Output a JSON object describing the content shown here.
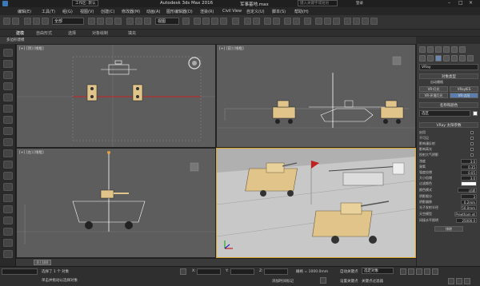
{
  "window": {
    "title": "Autodesk 3ds Max 2016",
    "file": "军事基地.max",
    "workspace": "工作区: 默认",
    "search_placeholder": "键入关键字或短语",
    "user": "登录"
  },
  "menu": [
    "编辑(E)",
    "工具(T)",
    "组(G)",
    "视图(V)",
    "创建(C)",
    "修改器(M)",
    "动画(A)",
    "图形编辑器(D)",
    "渲染(R)",
    "Civil View",
    "自定义(U)",
    "脚本(S)",
    "帮助(H)"
  ],
  "toolbar": {
    "selection_filter": "全部",
    "view_dropdown": "视图"
  },
  "ribbon": {
    "tabs": [
      "建模",
      "自由形式",
      "选择",
      "对象绘制",
      "填充"
    ],
    "sub": "多边形建模"
  },
  "viewports": {
    "top_label": "[+] [顶] [线框]",
    "front_label": "[+] [前] [线框]",
    "left_label": "[+] [左] [线框]",
    "persp_label": "[+] [透视] [真实]"
  },
  "command_panel": {
    "search_placeholder": "",
    "category": "VRay",
    "object_type_header": "对象类型",
    "auto_grid": "自动栅格",
    "buttons": [
      "VR-灯光",
      "VRayIES",
      "VR-环境灯光",
      "VR-太阳"
    ],
    "name_color_header": "名称和颜色",
    "name_value": "选区",
    "params_header": "VRay 太阳参数",
    "rows": [
      {
        "label": "启用",
        "type": "chk"
      },
      {
        "label": "不可见",
        "type": "chk"
      },
      {
        "label": "影响漫反射",
        "type": "chk"
      },
      {
        "label": "影响高光",
        "type": "chk"
      },
      {
        "label": "投射大气阴影",
        "type": "chk"
      },
      {
        "label": "浊度",
        "value": "3.0"
      },
      {
        "label": "臭氧",
        "value": "0.35"
      },
      {
        "label": "强度倍增",
        "value": "0.05"
      },
      {
        "label": "大小倍增",
        "value": "3.0"
      },
      {
        "label": "过滤颜色",
        "value": ""
      },
      {
        "label": "颜色模式",
        "value": "过滤"
      },
      {
        "label": "阴影细分",
        "value": "3"
      },
      {
        "label": "阴影偏移",
        "value": "0.2mm"
      },
      {
        "label": "光子发射半径",
        "value": "50.0mm"
      },
      {
        "label": "天空模型",
        "value": "Preetham et"
      },
      {
        "label": "间接水平照明",
        "value": "25000.0"
      },
      {
        "label": "排除",
        "value": ""
      }
    ]
  },
  "timeline": {
    "frame": "0 / 100"
  },
  "status": {
    "selected": "选择了 1 个 对象",
    "prompt": "单击并拖动以选择对象",
    "grid": "栅格 = 1000.0mm",
    "autokey": "自动关键点",
    "selected_dd": "选定对象",
    "setkey": "设置关键点",
    "keyfilter": "关键点过滤器",
    "add_time_tag": "添加时间标记",
    "coords": {
      "x": "X:",
      "y": "Y:",
      "z": "Z:"
    }
  },
  "colors": {
    "accent": "#d9a32a",
    "viewport_bg": "#5d5d5d",
    "persp_bg": "#a8a8a8",
    "tank": "#e0c48a"
  }
}
